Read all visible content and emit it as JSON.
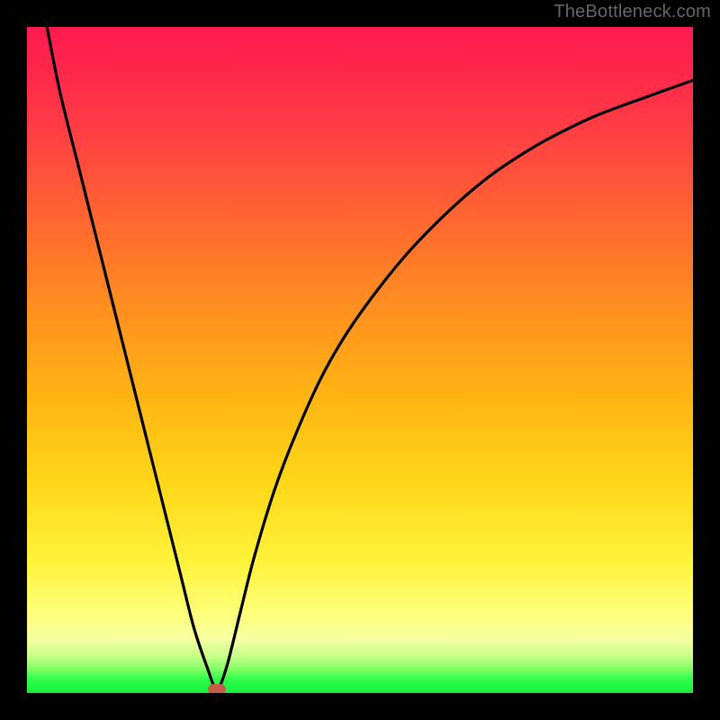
{
  "watermark": "TheBottleneck.com",
  "chart_data": {
    "type": "line",
    "title": "",
    "xlabel": "",
    "ylabel": "",
    "xlim": [
      0,
      100
    ],
    "ylim": [
      0,
      100
    ],
    "grid": false,
    "series": [
      {
        "name": "bottleneck-curve",
        "x": [
          3,
          5,
          8,
          11,
          14,
          17,
          20,
          23,
          25,
          27,
          28.5,
          30,
          32,
          34,
          37,
          40,
          44,
          48,
          53,
          58,
          64,
          70,
          77,
          85,
          93,
          100
        ],
        "y": [
          100,
          90,
          78,
          66,
          54,
          42,
          30,
          18,
          10,
          4,
          0.5,
          4,
          12,
          20,
          30,
          38,
          47,
          54,
          61,
          67,
          73,
          78,
          82.5,
          86.5,
          89.5,
          92
        ]
      }
    ],
    "minimum_marker": {
      "x": 28.5,
      "y": 0.5
    },
    "background_gradient": {
      "top_color": "#ff1a4f",
      "mid_color": "#ffd617",
      "bottom_color": "#17ef3d"
    },
    "curve_color": "#000000",
    "marker_color": "#c65c4a"
  }
}
